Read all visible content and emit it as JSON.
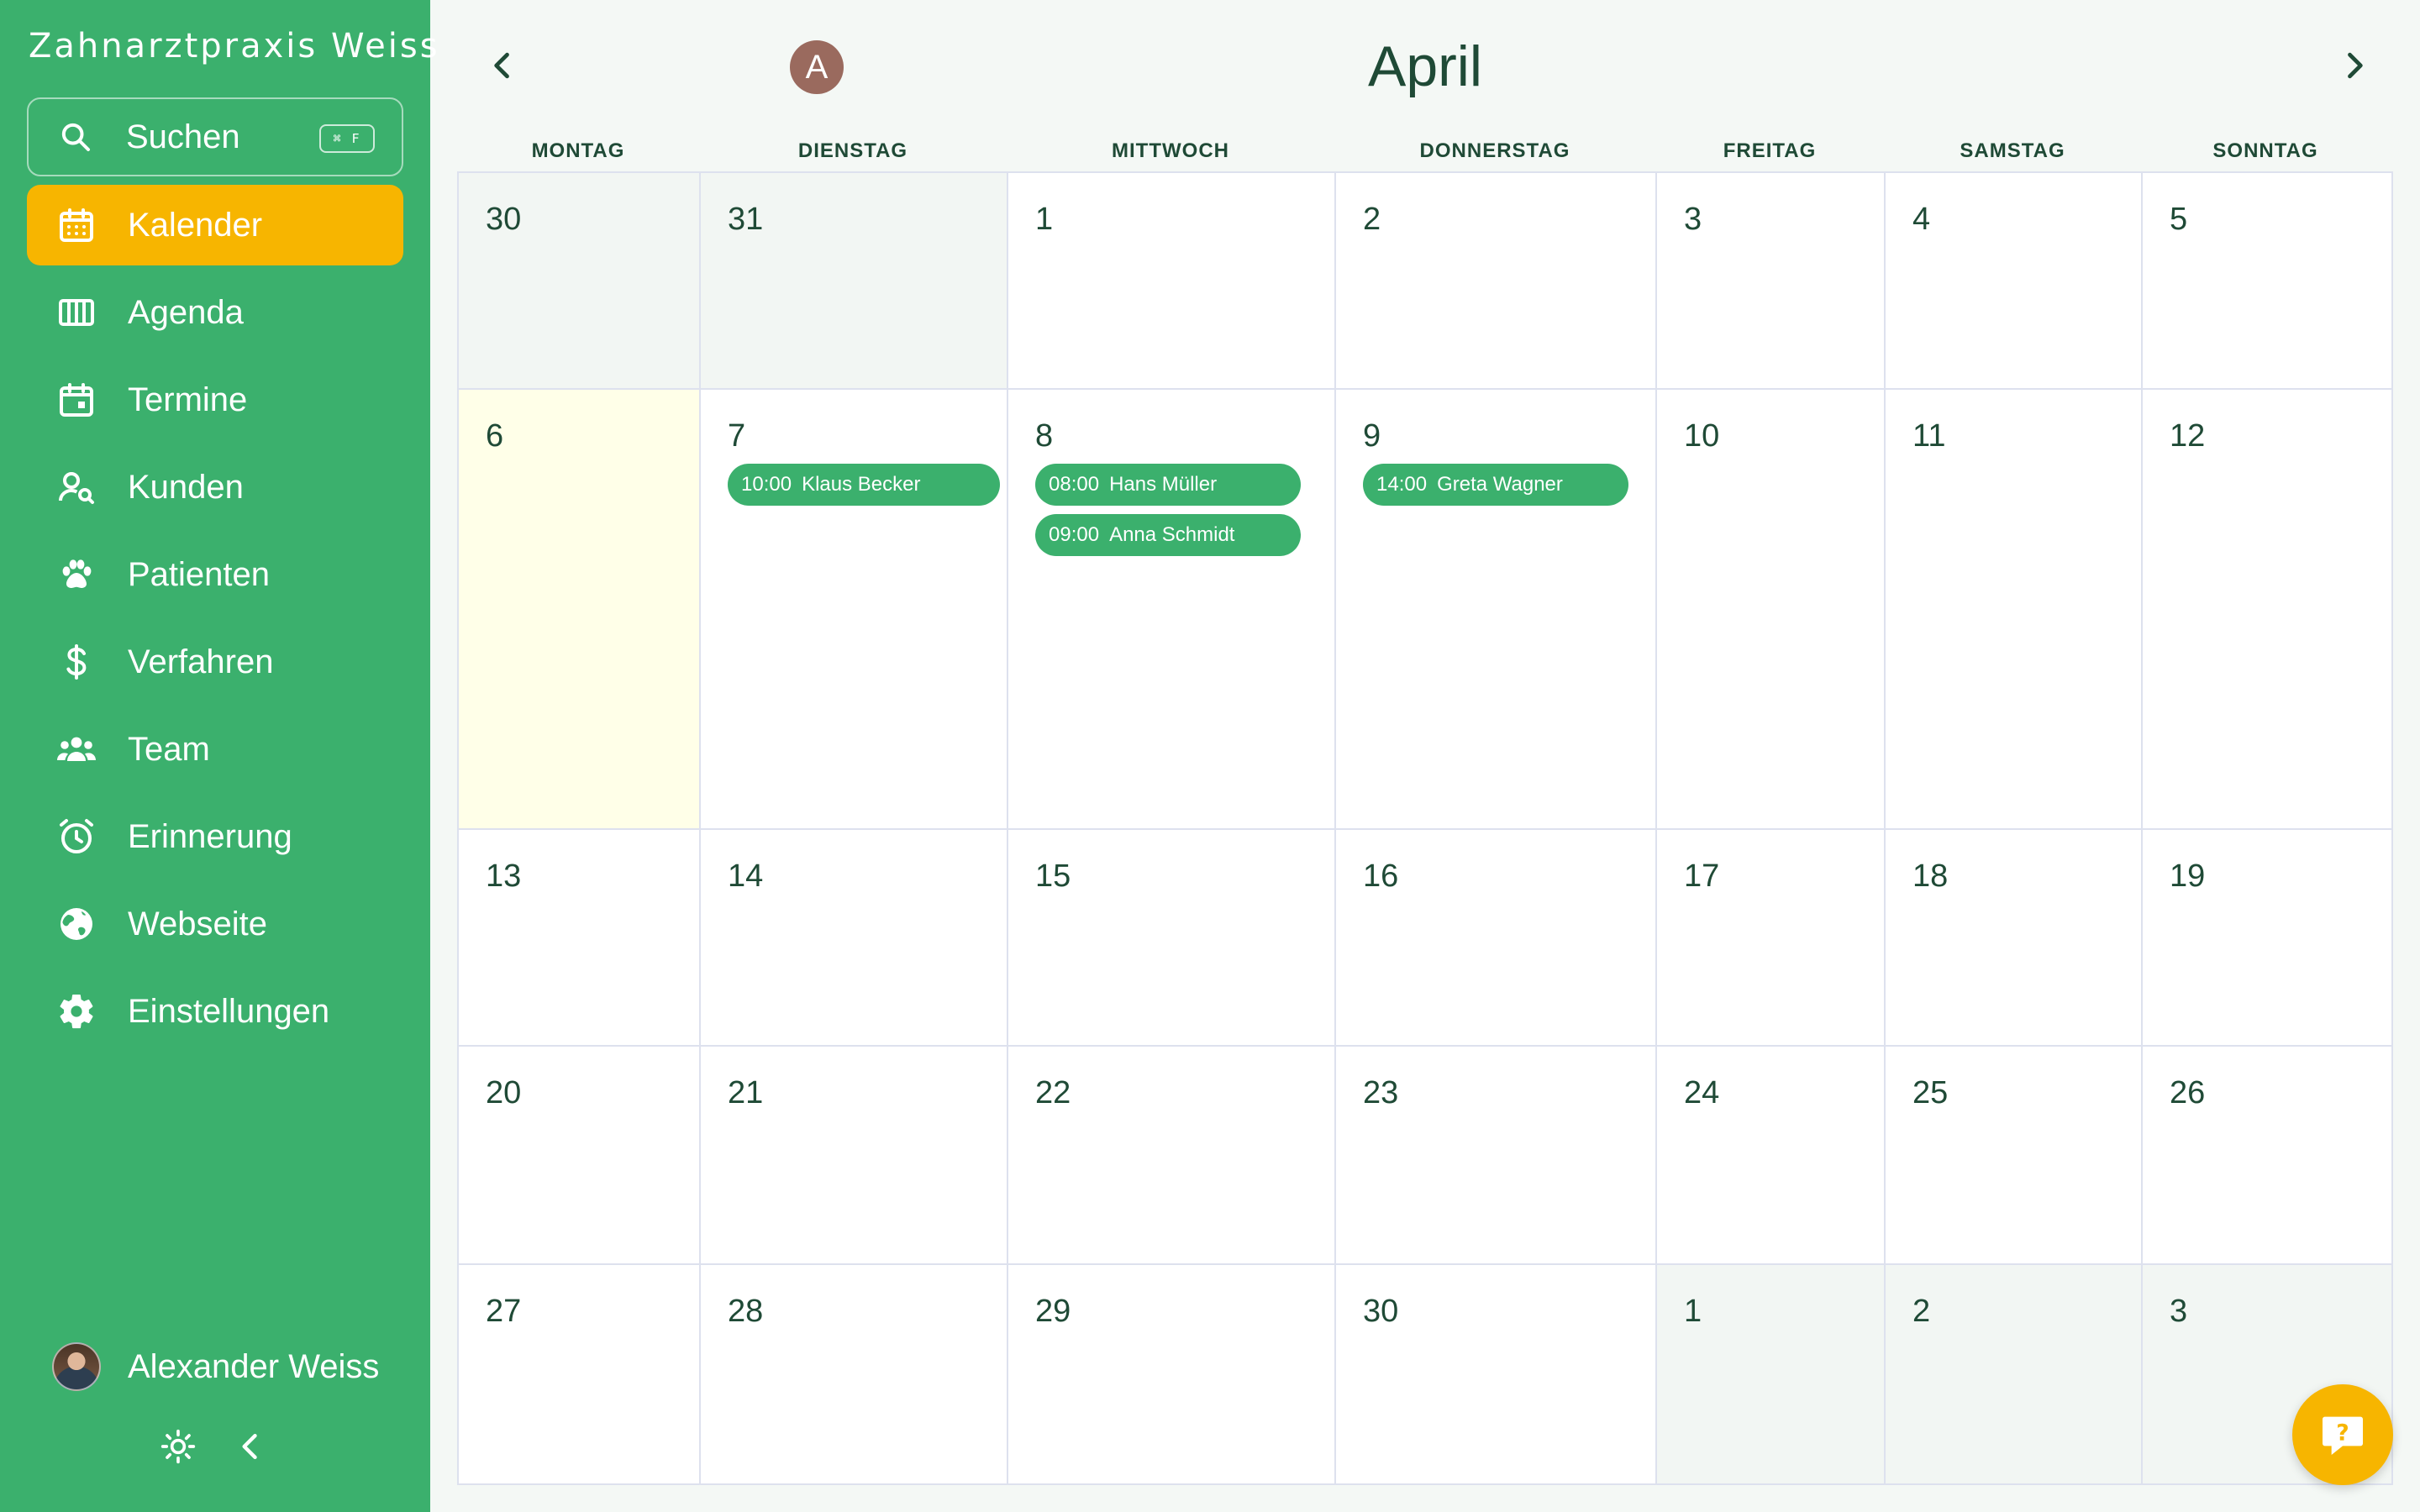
{
  "app": {
    "title": "Zahnarztpraxis Weiss"
  },
  "search": {
    "label": "Suchen",
    "shortcut": "⌘ F"
  },
  "sidebar": {
    "items": [
      {
        "label": "Kalender",
        "icon": "calendar-icon",
        "active": true
      },
      {
        "label": "Agenda",
        "icon": "columns-icon"
      },
      {
        "label": "Termine",
        "icon": "event-icon"
      },
      {
        "label": "Kunden",
        "icon": "user-search-icon"
      },
      {
        "label": "Patienten",
        "icon": "paw-icon"
      },
      {
        "label": "Verfahren",
        "icon": "dollar-icon"
      },
      {
        "label": "Team",
        "icon": "team-icon"
      },
      {
        "label": "Erinnerung",
        "icon": "alarm-icon"
      },
      {
        "label": "Webseite",
        "icon": "globe-icon"
      },
      {
        "label": "Einstellungen",
        "icon": "gear-icon"
      }
    ]
  },
  "user": {
    "name": "Alexander Weiss"
  },
  "calendar": {
    "month": "April",
    "view_avatar_letter": "A",
    "weekdays": [
      "MONTAG",
      "DIENSTAG",
      "MITTWOCH",
      "DONNERSTAG",
      "FREITAG",
      "SAMSTAG",
      "SONNTAG"
    ],
    "weeks": [
      [
        {
          "day": "30",
          "other": true
        },
        {
          "day": "31",
          "other": true
        },
        {
          "day": "1"
        },
        {
          "day": "2"
        },
        {
          "day": "3"
        },
        {
          "day": "4"
        },
        {
          "day": "5"
        }
      ],
      [
        {
          "day": "6",
          "today": true
        },
        {
          "day": "7"
        },
        {
          "day": "8"
        },
        {
          "day": "9"
        },
        {
          "day": "10"
        },
        {
          "day": "11"
        },
        {
          "day": "12"
        }
      ],
      [
        {
          "day": "13"
        },
        {
          "day": "14"
        },
        {
          "day": "15"
        },
        {
          "day": "16"
        },
        {
          "day": "17"
        },
        {
          "day": "18"
        },
        {
          "day": "19"
        }
      ],
      [
        {
          "day": "20"
        },
        {
          "day": "21"
        },
        {
          "day": "22"
        },
        {
          "day": "23"
        },
        {
          "day": "24"
        },
        {
          "day": "25"
        },
        {
          "day": "26"
        }
      ],
      [
        {
          "day": "27"
        },
        {
          "day": "28"
        },
        {
          "day": "29"
        },
        {
          "day": "30"
        },
        {
          "day": "1",
          "other": true
        },
        {
          "day": "2",
          "other": true
        },
        {
          "day": "3",
          "other": true
        }
      ]
    ],
    "events": [
      {
        "week": 1,
        "col": 1,
        "slot": 0,
        "time": "10:00",
        "name": "Klaus Becker"
      },
      {
        "week": 1,
        "col": 2,
        "slot": 0,
        "time": "08:00",
        "name": "Hans Müller"
      },
      {
        "week": 1,
        "col": 2,
        "slot": 1,
        "time": "09:00",
        "name": "Anna Schmidt"
      },
      {
        "week": 1,
        "col": 3,
        "slot": 0,
        "time": "14:00",
        "name": "Greta Wagner"
      }
    ]
  },
  "colors": {
    "accent": "#3bb06d",
    "active": "#f7b500",
    "today": "#ffffe8",
    "text": "#1f4a36"
  }
}
